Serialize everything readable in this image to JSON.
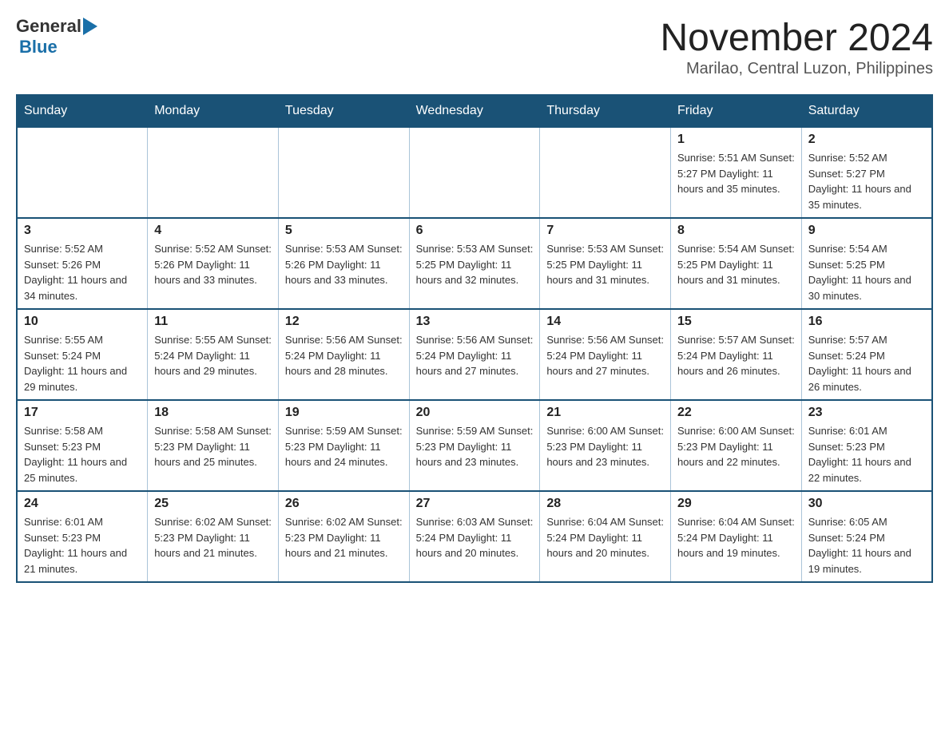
{
  "header": {
    "logo_general": "General",
    "logo_blue": "Blue",
    "main_title": "November 2024",
    "subtitle": "Marilao, Central Luzon, Philippines"
  },
  "calendar": {
    "days_of_week": [
      "Sunday",
      "Monday",
      "Tuesday",
      "Wednesday",
      "Thursday",
      "Friday",
      "Saturday"
    ],
    "weeks": [
      [
        {
          "day": "",
          "info": ""
        },
        {
          "day": "",
          "info": ""
        },
        {
          "day": "",
          "info": ""
        },
        {
          "day": "",
          "info": ""
        },
        {
          "day": "",
          "info": ""
        },
        {
          "day": "1",
          "info": "Sunrise: 5:51 AM\nSunset: 5:27 PM\nDaylight: 11 hours\nand 35 minutes."
        },
        {
          "day": "2",
          "info": "Sunrise: 5:52 AM\nSunset: 5:27 PM\nDaylight: 11 hours\nand 35 minutes."
        }
      ],
      [
        {
          "day": "3",
          "info": "Sunrise: 5:52 AM\nSunset: 5:26 PM\nDaylight: 11 hours\nand 34 minutes."
        },
        {
          "day": "4",
          "info": "Sunrise: 5:52 AM\nSunset: 5:26 PM\nDaylight: 11 hours\nand 33 minutes."
        },
        {
          "day": "5",
          "info": "Sunrise: 5:53 AM\nSunset: 5:26 PM\nDaylight: 11 hours\nand 33 minutes."
        },
        {
          "day": "6",
          "info": "Sunrise: 5:53 AM\nSunset: 5:25 PM\nDaylight: 11 hours\nand 32 minutes."
        },
        {
          "day": "7",
          "info": "Sunrise: 5:53 AM\nSunset: 5:25 PM\nDaylight: 11 hours\nand 31 minutes."
        },
        {
          "day": "8",
          "info": "Sunrise: 5:54 AM\nSunset: 5:25 PM\nDaylight: 11 hours\nand 31 minutes."
        },
        {
          "day": "9",
          "info": "Sunrise: 5:54 AM\nSunset: 5:25 PM\nDaylight: 11 hours\nand 30 minutes."
        }
      ],
      [
        {
          "day": "10",
          "info": "Sunrise: 5:55 AM\nSunset: 5:24 PM\nDaylight: 11 hours\nand 29 minutes."
        },
        {
          "day": "11",
          "info": "Sunrise: 5:55 AM\nSunset: 5:24 PM\nDaylight: 11 hours\nand 29 minutes."
        },
        {
          "day": "12",
          "info": "Sunrise: 5:56 AM\nSunset: 5:24 PM\nDaylight: 11 hours\nand 28 minutes."
        },
        {
          "day": "13",
          "info": "Sunrise: 5:56 AM\nSunset: 5:24 PM\nDaylight: 11 hours\nand 27 minutes."
        },
        {
          "day": "14",
          "info": "Sunrise: 5:56 AM\nSunset: 5:24 PM\nDaylight: 11 hours\nand 27 minutes."
        },
        {
          "day": "15",
          "info": "Sunrise: 5:57 AM\nSunset: 5:24 PM\nDaylight: 11 hours\nand 26 minutes."
        },
        {
          "day": "16",
          "info": "Sunrise: 5:57 AM\nSunset: 5:24 PM\nDaylight: 11 hours\nand 26 minutes."
        }
      ],
      [
        {
          "day": "17",
          "info": "Sunrise: 5:58 AM\nSunset: 5:23 PM\nDaylight: 11 hours\nand 25 minutes."
        },
        {
          "day": "18",
          "info": "Sunrise: 5:58 AM\nSunset: 5:23 PM\nDaylight: 11 hours\nand 25 minutes."
        },
        {
          "day": "19",
          "info": "Sunrise: 5:59 AM\nSunset: 5:23 PM\nDaylight: 11 hours\nand 24 minutes."
        },
        {
          "day": "20",
          "info": "Sunrise: 5:59 AM\nSunset: 5:23 PM\nDaylight: 11 hours\nand 23 minutes."
        },
        {
          "day": "21",
          "info": "Sunrise: 6:00 AM\nSunset: 5:23 PM\nDaylight: 11 hours\nand 23 minutes."
        },
        {
          "day": "22",
          "info": "Sunrise: 6:00 AM\nSunset: 5:23 PM\nDaylight: 11 hours\nand 22 minutes."
        },
        {
          "day": "23",
          "info": "Sunrise: 6:01 AM\nSunset: 5:23 PM\nDaylight: 11 hours\nand 22 minutes."
        }
      ],
      [
        {
          "day": "24",
          "info": "Sunrise: 6:01 AM\nSunset: 5:23 PM\nDaylight: 11 hours\nand 21 minutes."
        },
        {
          "day": "25",
          "info": "Sunrise: 6:02 AM\nSunset: 5:23 PM\nDaylight: 11 hours\nand 21 minutes."
        },
        {
          "day": "26",
          "info": "Sunrise: 6:02 AM\nSunset: 5:23 PM\nDaylight: 11 hours\nand 21 minutes."
        },
        {
          "day": "27",
          "info": "Sunrise: 6:03 AM\nSunset: 5:24 PM\nDaylight: 11 hours\nand 20 minutes."
        },
        {
          "day": "28",
          "info": "Sunrise: 6:04 AM\nSunset: 5:24 PM\nDaylight: 11 hours\nand 20 minutes."
        },
        {
          "day": "29",
          "info": "Sunrise: 6:04 AM\nSunset: 5:24 PM\nDaylight: 11 hours\nand 19 minutes."
        },
        {
          "day": "30",
          "info": "Sunrise: 6:05 AM\nSunset: 5:24 PM\nDaylight: 11 hours\nand 19 minutes."
        }
      ]
    ]
  }
}
